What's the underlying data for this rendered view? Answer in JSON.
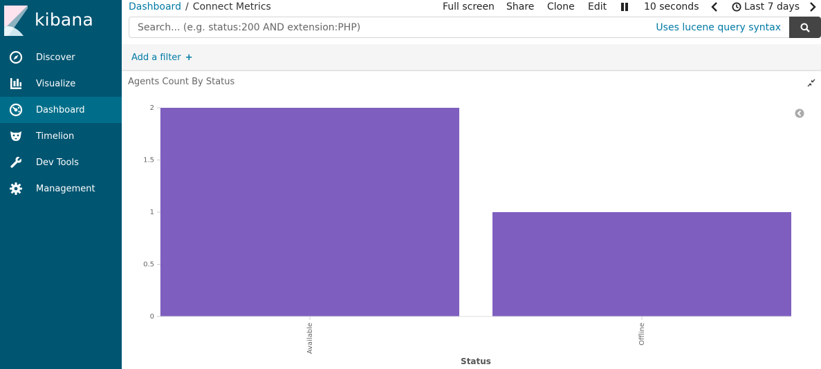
{
  "app": {
    "logo_text": "kibana"
  },
  "sidebar": {
    "items": [
      {
        "label": "Discover",
        "icon": "compass-icon"
      },
      {
        "label": "Visualize",
        "icon": "bar-chart-icon"
      },
      {
        "label": "Dashboard",
        "icon": "dashboard-icon",
        "active": true
      },
      {
        "label": "Timelion",
        "icon": "timelion-icon"
      },
      {
        "label": "Dev Tools",
        "icon": "wrench-icon"
      },
      {
        "label": "Management",
        "icon": "gear-icon"
      }
    ]
  },
  "breadcrumb": {
    "parent": "Dashboard",
    "separator": "/",
    "current": "Connect Metrics"
  },
  "top_menu": {
    "full_screen": "Full screen",
    "share": "Share",
    "clone": "Clone",
    "edit": "Edit",
    "refresh_interval": "10 seconds",
    "time_range": "Last 7 days"
  },
  "search": {
    "placeholder": "Search... (e.g. status:200 AND extension:PHP)",
    "value": "",
    "syntax_link": "Uses lucene query syntax"
  },
  "filter": {
    "add_label": "Add a filter",
    "add_icon": "plus-icon"
  },
  "panel": {
    "title": "Agents Count By Status"
  },
  "colors": {
    "sidebar": "#005571",
    "sidebar_active": "#006e8a",
    "link": "#0079a5",
    "bar": "#7e5fbf"
  },
  "chart_data": {
    "type": "bar",
    "title": "Agents Count By Status",
    "categories": [
      "Available",
      "Offline"
    ],
    "values": [
      2,
      1
    ],
    "xlabel": "Status",
    "ylabel": "",
    "ylim": [
      0,
      2
    ],
    "yticks": [
      0,
      0.5,
      1,
      1.5,
      2
    ],
    "ytick_labels": [
      "0",
      "0.5",
      "1",
      "1.5",
      "2"
    ],
    "grid": false,
    "color": "#7e5fbf"
  }
}
